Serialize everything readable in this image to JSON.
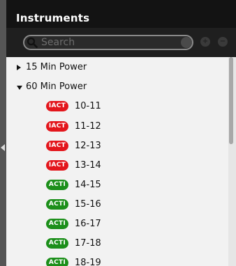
{
  "panel": {
    "title": "Instruments"
  },
  "search": {
    "placeholder": "Search",
    "value": ""
  },
  "icons": {
    "search": "magnifier-icon",
    "clear": "clear-icon",
    "add": "plus-icon",
    "remove": "minus-icon",
    "collapse": "collapse-left-icon"
  },
  "groups": [
    {
      "label": "15 Min Power",
      "expanded": false
    },
    {
      "label": "60 Min Power",
      "expanded": true
    }
  ],
  "items": [
    {
      "badge": "IACT",
      "status": "inactive",
      "label": "10-11"
    },
    {
      "badge": "IACT",
      "status": "inactive",
      "label": "11-12"
    },
    {
      "badge": "IACT",
      "status": "inactive",
      "label": "12-13"
    },
    {
      "badge": "IACT",
      "status": "inactive",
      "label": "13-14"
    },
    {
      "badge": "ACTI",
      "status": "active",
      "label": "14-15"
    },
    {
      "badge": "ACTI",
      "status": "active",
      "label": "15-16"
    },
    {
      "badge": "ACTI",
      "status": "active",
      "label": "16-17"
    },
    {
      "badge": "ACTI",
      "status": "active",
      "label": "17-18"
    },
    {
      "badge": "ACTI",
      "status": "active",
      "label": "18-19"
    }
  ],
  "colors": {
    "inactive_badge": "#e3161c",
    "active_badge": "#1c8f1a",
    "title_bar": "#131313",
    "list_background": "#f2f2f2"
  }
}
